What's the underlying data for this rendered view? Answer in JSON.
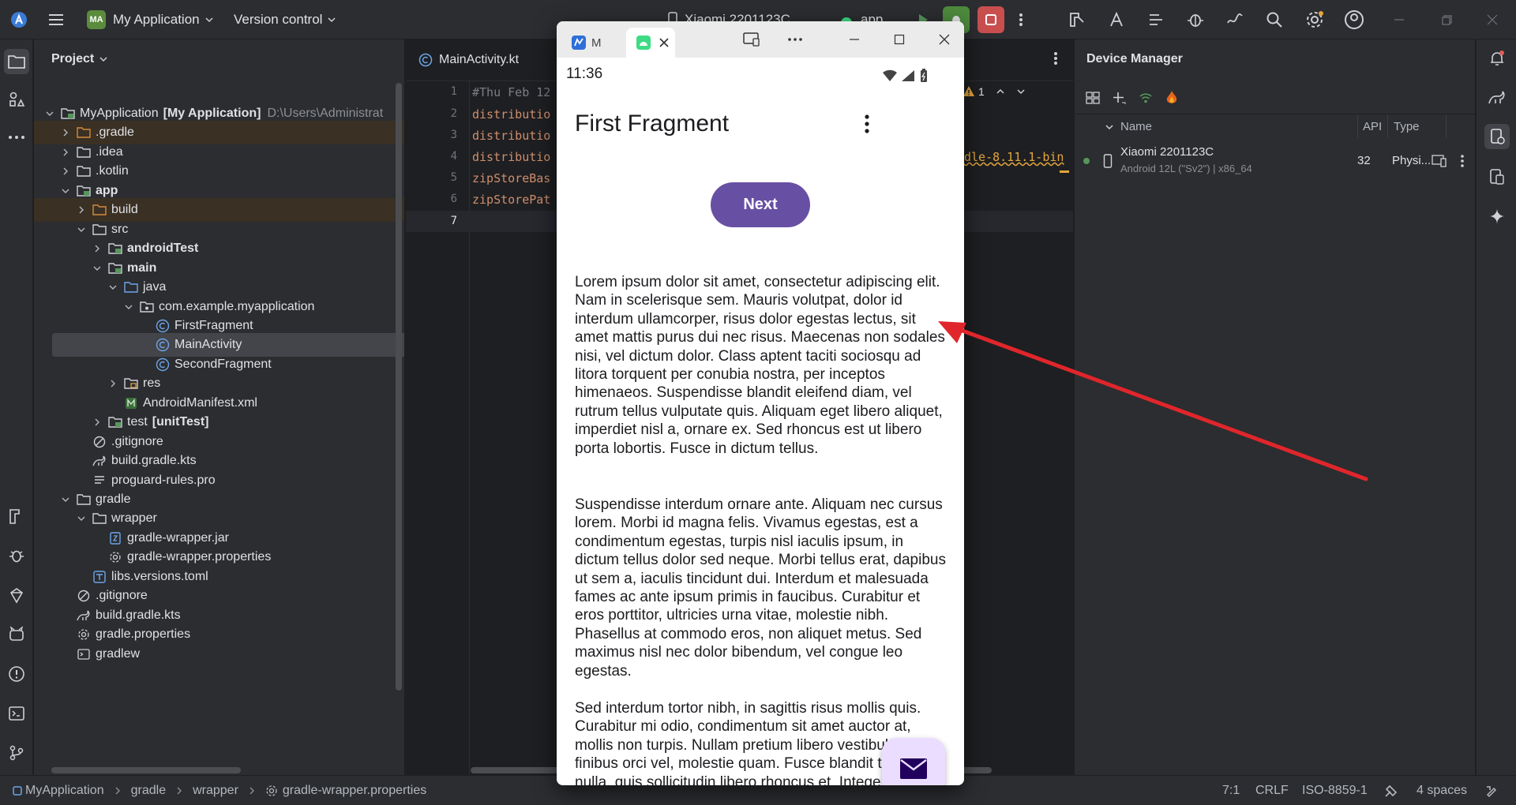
{
  "topbar": {
    "project_initials": "MA",
    "project_name": "My Application",
    "vcs_label": "Version control",
    "device_label": "Xiaomi 2201123C",
    "run_config": "app"
  },
  "project_panel": {
    "title": "Project",
    "tree": [
      {
        "label": "MyApplication",
        "bold_suffix": "[My Application]",
        "hint": "D:\\Users\\Administrat"
      },
      {
        "label": ".gradle"
      },
      {
        "label": ".idea"
      },
      {
        "label": ".kotlin"
      },
      {
        "label": "app"
      },
      {
        "label": "build"
      },
      {
        "label": "src"
      },
      {
        "label": "androidTest"
      },
      {
        "label": "main"
      },
      {
        "label": "java"
      },
      {
        "label": "com.example.myapplication"
      },
      {
        "label": "FirstFragment"
      },
      {
        "label": "MainActivity"
      },
      {
        "label": "SecondFragment"
      },
      {
        "label": "res"
      },
      {
        "label": "AndroidManifest.xml"
      },
      {
        "label": "test",
        "bold_suffix": "[unitTest]"
      },
      {
        "label": ".gitignore"
      },
      {
        "label": "build.gradle.kts"
      },
      {
        "label": "proguard-rules.pro"
      },
      {
        "label": "gradle"
      },
      {
        "label": "wrapper"
      },
      {
        "label": "gradle-wrapper.jar"
      },
      {
        "label": "gradle-wrapper.properties"
      },
      {
        "label": "libs.versions.toml"
      },
      {
        "label": ".gitignore"
      },
      {
        "label": "build.gradle.kts"
      },
      {
        "label": "gradle.properties"
      },
      {
        "label": "gradlew"
      }
    ]
  },
  "editor": {
    "tab_label": "MainActivity.kt",
    "warning_count": "1",
    "line_numbers": [
      "1",
      "2",
      "3",
      "4",
      "5",
      "6",
      "7"
    ],
    "lines": [
      "#Thu Feb 12",
      "distributio",
      "distributio",
      "distributio",
      "zipStoreBas",
      "zipStorePat",
      ""
    ],
    "overflow_text": "dle-8.11.1-bin"
  },
  "device_manager": {
    "title": "Device Manager",
    "columns": {
      "name": "Name",
      "api": "API",
      "type": "Type"
    },
    "devices": [
      {
        "name": "Xiaomi 2201123C",
        "detail": "Android 12L (\"Sv2\") | x86_64",
        "api": "32",
        "type": "Physi..."
      }
    ]
  },
  "statusbar": {
    "breadcrumbs": [
      "MyApplication",
      "gradle",
      "wrapper",
      "gradle-wrapper.properties"
    ],
    "position": "7:1",
    "line_sep": "CRLF",
    "encoding": "ISO-8859-1",
    "indent": "4 spaces"
  },
  "emulator": {
    "tab1_label": "M",
    "time": "11:36",
    "app_title": "First Fragment",
    "next_button": "Next",
    "paragraphs": [
      "Lorem ipsum dolor sit amet, consectetur adipiscing elit. Nam in scelerisque sem. Mauris volutpat, dolor id interdum ullamcorper, risus dolor egestas lectus, sit amet mattis purus dui nec risus. Maecenas non sodales nisi, vel dictum dolor. Class aptent taciti sociosqu ad litora torquent per conubia nostra, per inceptos himenaeos. Suspendisse blandit eleifend diam, vel rutrum tellus vulputate quis. Aliquam eget libero aliquet, imperdiet nisl a, ornare ex. Sed rhoncus est ut libero porta lobortis. Fusce in dictum tellus.",
      " Suspendisse interdum ornare ante. Aliquam nec cursus lorem. Morbi id magna felis. Vivamus egestas, est a condimentum egestas, turpis nisl iaculis ipsum, in dictum tellus dolor sed neque. Morbi tellus erat, dapibus ut sem a, iaculis tincidunt dui. Interdum et malesuada fames ac ante ipsum primis in faucibus. Curabitur et eros porttitor, ultricies urna vitae, molestie nibh. Phasellus at commodo eros, non aliquet metus. Sed maximus nisl nec dolor bibendum, vel congue leo egestas.",
      " Sed interdum tortor nibh, in sagittis risus mollis quis. Curabitur mi odio, condimentum sit amet auctor at, mollis non turpis. Nullam pretium libero vestibulum, finibus orci vel, molestie quam. Fusce blandit tincidunt nulla, quis sollicitudin libero rhoncus et. Integer interdum nunc ligula, et fermentum metus"
    ]
  },
  "colors": {
    "accent_purple": "#6750a4",
    "fab_bg": "#ebddff",
    "arrow_red": "#e0262b"
  }
}
